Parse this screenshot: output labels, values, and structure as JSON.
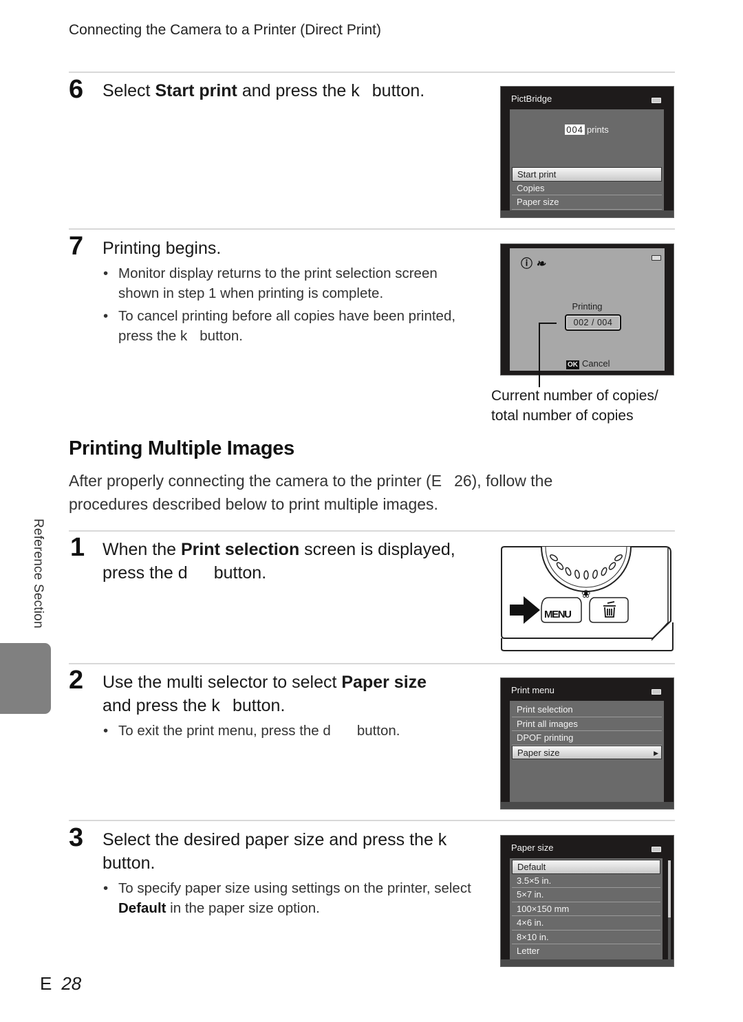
{
  "running_head": "Connecting the Camera to a Printer (Direct Print)",
  "step6": {
    "number": "6",
    "text_a": "Select ",
    "text_bold": "Start print",
    "text_b": " and press the k",
    "text_c": "button.",
    "screen": {
      "title": "PictBridge",
      "count": "004",
      "count_label": "prints",
      "items": [
        "Start print",
        "Copies",
        "Paper size"
      ],
      "selected_index": 0
    }
  },
  "step7": {
    "number": "7",
    "title": "Printing begins.",
    "bullets": [
      "Monitor display returns to the print selection screen shown in step 1 when printing is complete.",
      "To cancel printing before all copies have been printed, press the k"
    ],
    "bullet2_tail": "button.",
    "screen": {
      "status_label": "Printing",
      "current": "002",
      "total": "004",
      "separator": "/",
      "ok_label": "OK",
      "cancel_label": "Cancel",
      "icons": [
        "warning-icon",
        "pictbridge-icon",
        "battery-icon"
      ]
    },
    "callout": [
      "Current number of copies/",
      "total number of copies"
    ]
  },
  "section": {
    "title": "Printing Multiple Images",
    "intro_a": "After properly connecting the camera to the printer (E",
    "intro_b": "26), follow the procedures described below to print multiple images."
  },
  "step1": {
    "number": "1",
    "text_a": "When the ",
    "text_bold": "Print selection",
    "text_b": " screen is displayed,",
    "line2_a": "press the d",
    "line2_b": "button.",
    "camera": {
      "menu_button": "MENU",
      "icons": [
        "arrow-right-icon",
        "macro-flower-icon",
        "trash-icon"
      ]
    }
  },
  "step2": {
    "number": "2",
    "text_a": "Use the multi selector to select ",
    "text_bold": "Paper size",
    "line2_a": "and press the k",
    "line2_b": "button.",
    "bullet_a": "To exit the print menu, press the d",
    "bullet_b": "button.",
    "screen": {
      "title": "Print menu",
      "items": [
        "Print selection",
        "Print all images",
        "DPOF printing",
        "Paper size"
      ],
      "selected_index": 3
    }
  },
  "step3": {
    "number": "3",
    "text_a": "Select the desired paper size and press the k",
    "line2": "button.",
    "bullet_a": "To specify paper size using settings on the printer, select ",
    "bullet_bold": "Default",
    "bullet_b": " in the paper size option.",
    "screen": {
      "title": "Paper size",
      "items": [
        "Default",
        "3.5×5 in.",
        "5×7 in.",
        "100×150 mm",
        "4×6 in.",
        "8×10 in.",
        "Letter"
      ],
      "selected_index": 0,
      "scroll_fraction": 0.55
    }
  },
  "side_tab": {
    "label": "Reference Section"
  },
  "footer": {
    "prefix": "E",
    "page": "28"
  }
}
